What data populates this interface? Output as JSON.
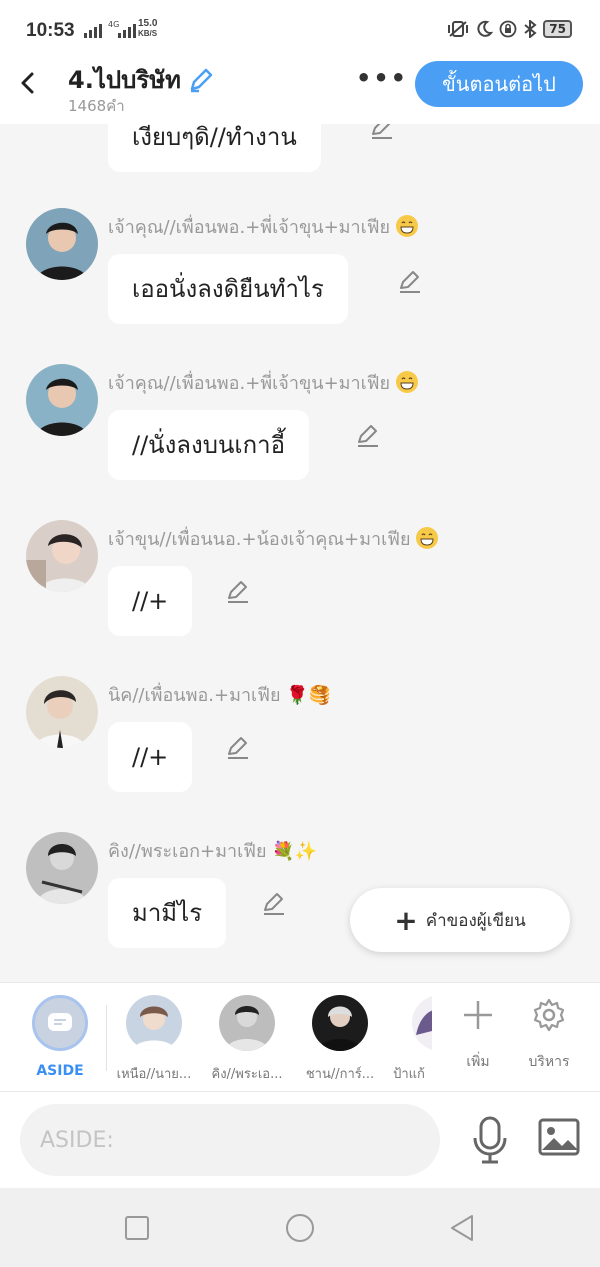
{
  "status_bar": {
    "time": "10:53",
    "network": "4G",
    "speed_value": "15.0",
    "speed_unit": "KB/S",
    "battery": "75"
  },
  "header": {
    "title": "4.ไปบริษัท",
    "word_count": "1468คำ",
    "next_button": "ขั้นตอนต่อไป"
  },
  "messages": [
    {
      "name": "",
      "text": "เงียบๆดิ//ทำงาน"
    },
    {
      "name": "เจ้าคุณ//เพื่อนพอ.+พี่เจ้าขุน+มาเฟีย",
      "text": "เออนั่งลงดิยืนทำไร",
      "emoji": "grin"
    },
    {
      "name": "เจ้าคุณ//เพื่อนพอ.+พี่เจ้าขุน+มาเฟีย",
      "text": "//นั่งลงบนเกาอี้",
      "emoji": "grin"
    },
    {
      "name": "เจ้าขุน//เพื่อนนอ.+น้องเจ้าคุณ+มาเฟีย",
      "text": "//+",
      "emoji": "grin"
    },
    {
      "name": "นิค//เพื่อนพอ.+มาเฟีย",
      "text": "//+",
      "emoji": "rose-pancake"
    },
    {
      "name": "คิง//พระเอก+มาเฟีย",
      "text": "มามีไร",
      "emoji": "bouquet-sparkles"
    }
  ],
  "fab": {
    "label": "คำของผู้เขียน"
  },
  "characters": [
    {
      "label": "ASIDE"
    },
    {
      "label": "เหนือ//นาย..."
    },
    {
      "label": "คิง//พระเอ..."
    },
    {
      "label": "ชาน//การ์..."
    },
    {
      "label": "ป้าแก้"
    }
  ],
  "tools": {
    "add": "เพิ่ม",
    "manage": "บริหาร"
  },
  "input": {
    "placeholder": "ASIDE:"
  },
  "colors": {
    "accent": "#4a9ff5",
    "aside": "#3a8ff2",
    "background": "#f5f5f5"
  }
}
